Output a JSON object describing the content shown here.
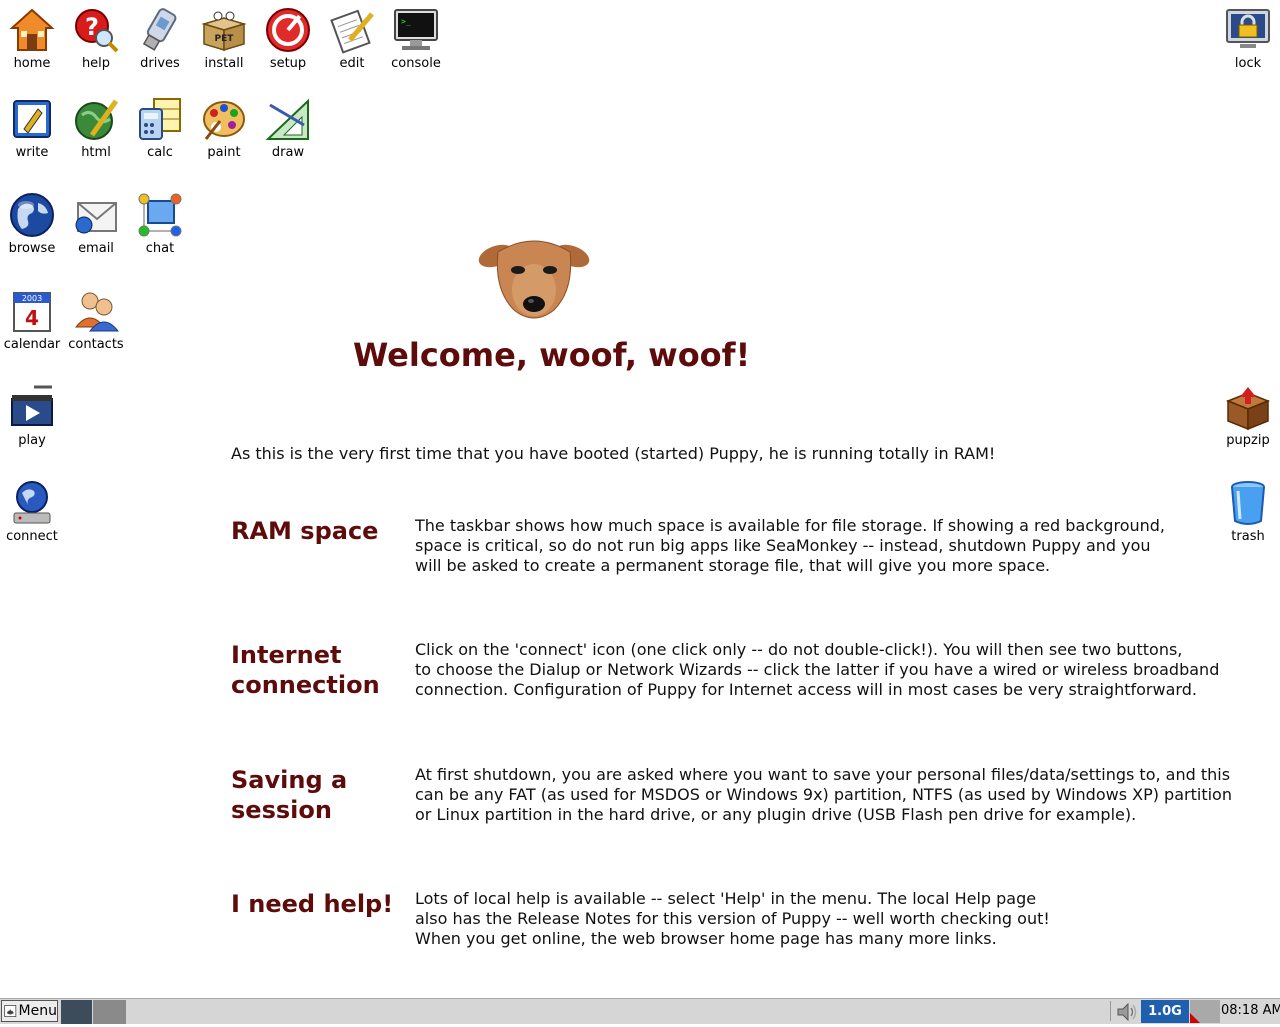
{
  "desktop_icons": {
    "home": "home",
    "help": "help",
    "drives": "drives",
    "install": "install",
    "setup": "setup",
    "edit": "edit",
    "console": "console",
    "lock": "lock",
    "write": "write",
    "html": "html",
    "calc": "calc",
    "paint": "paint",
    "draw": "draw",
    "browse": "browse",
    "email": "email",
    "chat": "chat",
    "calendar": "calendar",
    "contacts": "contacts",
    "play": "play",
    "connect": "connect",
    "pupzip": "pupzip",
    "trash": "trash",
    "install_badge": "PET",
    "calendar_year": "2003",
    "calendar_day": "4"
  },
  "welcome": {
    "title": "Welcome, woof, woof!",
    "intro": "As this is the very first time that you have booted (started) Puppy, he is running totally in RAM!",
    "sections": [
      {
        "heading_lines": [
          "RAM space"
        ],
        "body_lines": [
          "The taskbar shows how much space is available for file storage. If showing a red background,",
          "space is critical, so do not run big apps like SeaMonkey -- instead, shutdown Puppy and you",
          "will be asked to create a permanent storage file, that will give you more space."
        ]
      },
      {
        "heading_lines": [
          "Internet",
          "connection"
        ],
        "body_lines": [
          "Click on the 'connect' icon  (one click only -- do not double-click!). You will then see two buttons,",
          "to choose the Dialup or Network Wizards -- click the latter if you have a wired or wireless broadband",
          "connection. Configuration of Puppy for Internet access will in most cases be very straightforward."
        ]
      },
      {
        "heading_lines": [
          "Saving a",
          "session"
        ],
        "body_lines": [
          "At first shutdown, you are asked where you want to save your personal files/data/settings to, and this",
          "can be any FAT (as used for MSDOS or Windows 9x) partition, NTFS (as used by Windows XP) partition",
          "or Linux partition in the hard drive, or any plugin drive (USB Flash pen drive for example)."
        ]
      },
      {
        "heading_lines": [
          "I need help!"
        ],
        "body_lines": [
          "Lots of local help is available -- select 'Help' in the menu. The local Help page",
          "also has the Release Notes for this version of Puppy -- well worth checking out!",
          "When you get online, the web browser home page has many more links."
        ]
      }
    ]
  },
  "taskbar": {
    "menu_label": "Menu",
    "ram_free": "1.0G",
    "clock": "08:18 AM"
  },
  "colors": {
    "heading": "#5e0b0b",
    "taskbar_bg": "#d6d6d6",
    "ram_indicator": "#1e5fae",
    "low_space_flag": "#d40000"
  }
}
